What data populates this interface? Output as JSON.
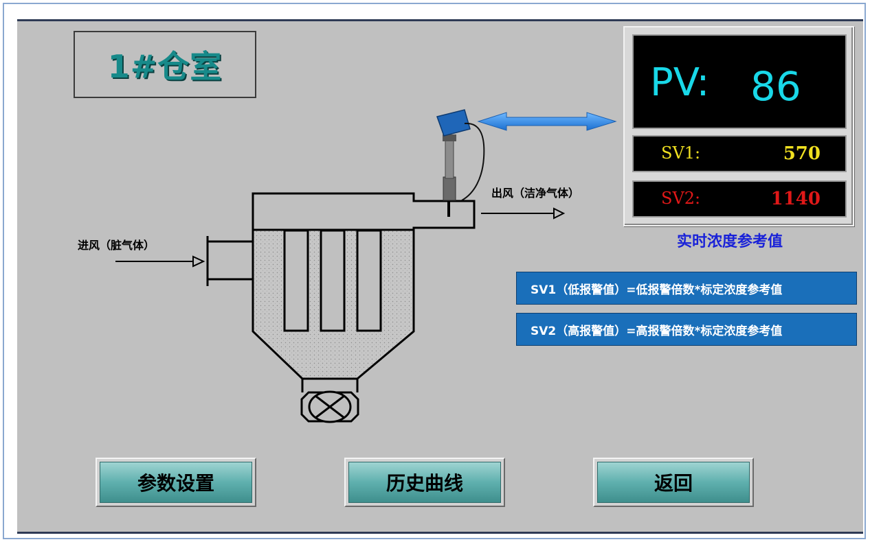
{
  "title": "1#仓室",
  "labels": {
    "inlet": "进风（脏气体）",
    "outlet": "出风（洁净气体）"
  },
  "readout": {
    "pv_label": "PV:",
    "pv_value": "86",
    "sv1_label": "SV1:",
    "sv1_value": "570",
    "sv2_label": "SV2:",
    "sv2_value": "1140",
    "caption": "实时浓度参考值"
  },
  "formulas": {
    "sv1": "SV1（低报警值）=低报警倍数*标定浓度参考值",
    "sv2": "SV2（高报警值）=高报警倍数*标定浓度参考值"
  },
  "buttons": {
    "params": "参数设置",
    "history": "历史曲线",
    "back": "返回"
  },
  "colors": {
    "pv": "#19d8e8",
    "sv1": "#f0e020",
    "sv2": "#e01818",
    "caption": "#1a22d8",
    "formula_bg": "#1a6fba",
    "title": "#178a8a"
  }
}
